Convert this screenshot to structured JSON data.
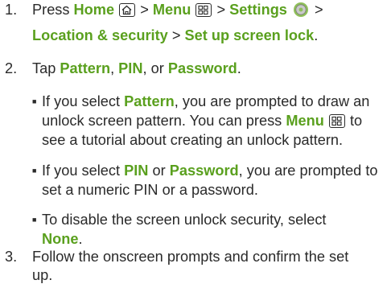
{
  "steps": {
    "s1": {
      "number": "1.",
      "line1": {
        "t1": "Press ",
        "home": "Home",
        "sep1": " > ",
        "menu": "Menu",
        "sep2": " > ",
        "settings": "Settings",
        "sep3": " >"
      },
      "line2": {
        "location": "Location & security",
        "sep": " > ",
        "setup": "Set up screen lock",
        "end": "."
      }
    },
    "s2": {
      "number": "2.",
      "line1": {
        "t1": "Tap ",
        "pattern": "Pattern",
        "c1": ", ",
        "pin": "PIN",
        "c2": ", or ",
        "password": "Password",
        "end": "."
      },
      "bullets": {
        "b1": {
          "l1": {
            "t1": "If you select ",
            "pattern": "Pattern",
            "t2": ", you are prompted to draw an"
          },
          "l2": {
            "t1": "unlock screen pattern. You can press ",
            "menu": "Menu",
            "t2": " to"
          },
          "l3": "see a tutorial about creating an unlock pattern."
        },
        "b2": {
          "l1": {
            "t1": "If you select ",
            "pin": "PIN",
            "t2": " or ",
            "password": "Password",
            "t3": ", you are prompted to"
          },
          "l2": "set a numeric PIN or a password."
        },
        "b3": {
          "l1": "To disable the screen unlock security, select",
          "l2": {
            "none": "None",
            "end": "."
          }
        }
      }
    },
    "s3": {
      "number": "3.",
      "line1": "Follow the onscreen prompts and confirm the set",
      "line2": "up."
    }
  },
  "icons": [
    "home-key-icon",
    "menu-key-icon",
    "settings-gear-icon"
  ],
  "colors": {
    "accent": "#5aa01e",
    "text": "#2a2a2a",
    "background": "#ffffff"
  }
}
